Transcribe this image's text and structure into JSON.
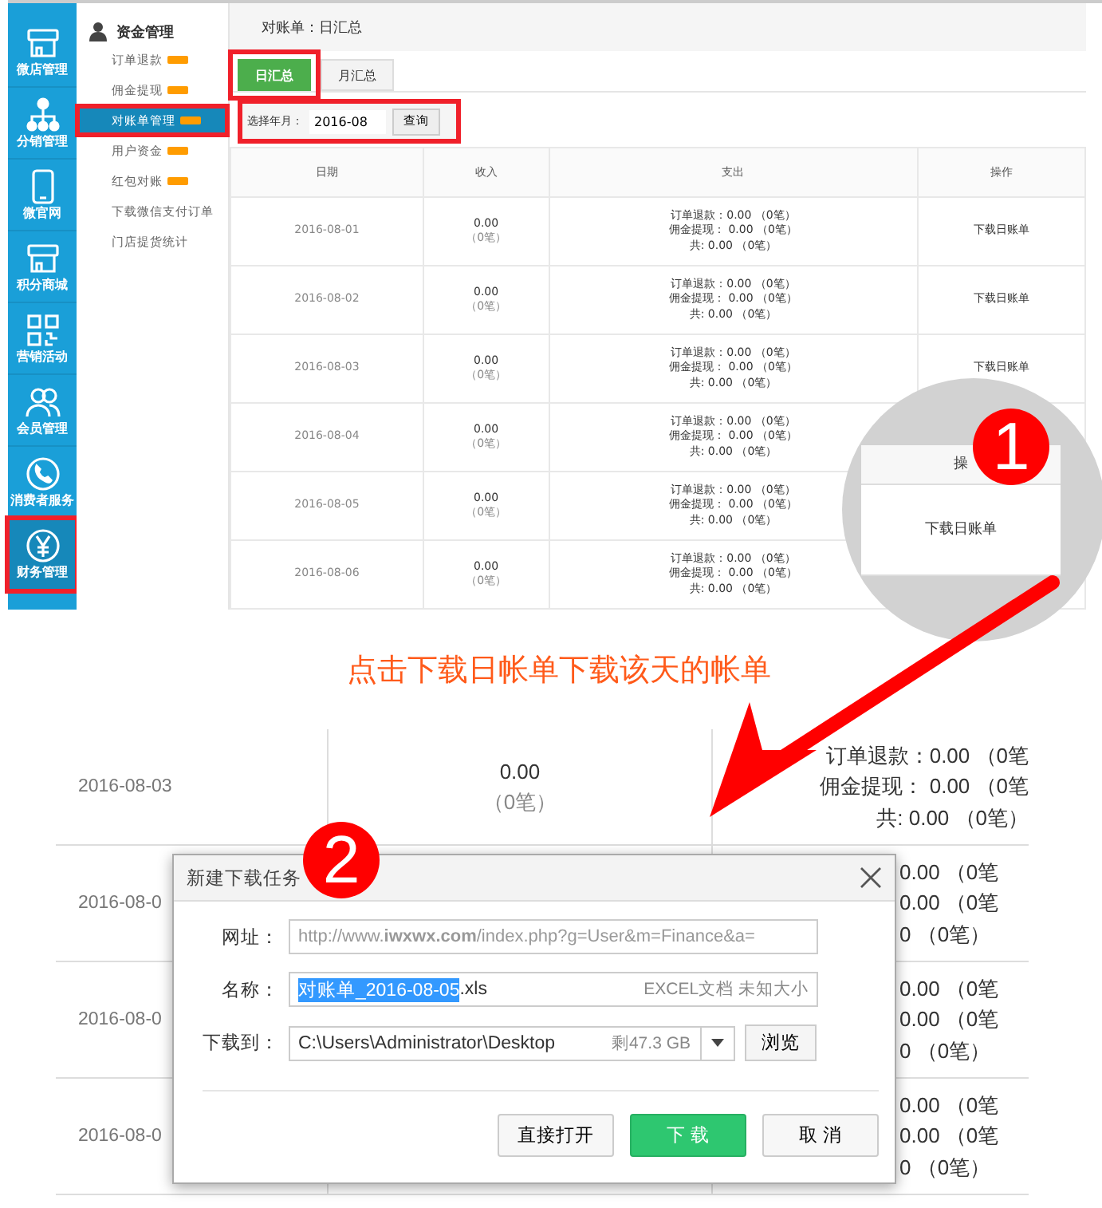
{
  "icon_sidebar": {
    "items": [
      {
        "label": "微店管理",
        "kind": "shop",
        "selected": false,
        "highlighted": false
      },
      {
        "label": "分销管理",
        "kind": "network",
        "selected": false,
        "highlighted": false
      },
      {
        "label": "微官网",
        "kind": "phone",
        "selected": false,
        "highlighted": false
      },
      {
        "label": "积分商城",
        "kind": "shop",
        "selected": false,
        "highlighted": false
      },
      {
        "label": "营销活动",
        "kind": "qr",
        "selected": false,
        "highlighted": false
      },
      {
        "label": "会员管理",
        "kind": "people",
        "selected": false,
        "highlighted": false
      },
      {
        "label": "消费者服务",
        "kind": "call",
        "selected": false,
        "highlighted": false
      },
      {
        "label": "财务管理",
        "kind": "yuan",
        "selected": true,
        "highlighted": true
      }
    ]
  },
  "submenu": {
    "title": "资金管理",
    "items": [
      {
        "label": "订单退款",
        "new": true,
        "selected": false,
        "highlighted": false
      },
      {
        "label": "佣金提现",
        "new": true,
        "selected": false,
        "highlighted": false
      },
      {
        "label": "对账单管理",
        "new": true,
        "selected": true,
        "highlighted": true
      },
      {
        "label": "用户资金",
        "new": true,
        "selected": false,
        "highlighted": false
      },
      {
        "label": "红包对账",
        "new": true,
        "selected": false,
        "highlighted": false
      },
      {
        "label": "下载微信支付订单",
        "new": false,
        "selected": false,
        "highlighted": false
      },
      {
        "label": "门店提货统计",
        "new": false,
        "selected": false,
        "highlighted": false
      }
    ]
  },
  "breadcrumb": "对账单：日汇总",
  "tabs": [
    {
      "label": "日汇总",
      "selected": true,
      "highlighted": true
    },
    {
      "label": "月汇总",
      "selected": false,
      "highlighted": false
    }
  ],
  "filter": {
    "label": "选择年月：",
    "value": "2016-08",
    "button": "查询",
    "highlighted": true
  },
  "table": {
    "columns": [
      "日期",
      "收入",
      "支出",
      "操作"
    ],
    "rows": [
      {
        "date": "2016-08-01",
        "income": "0.00",
        "income_count": "（0笔）",
        "expense_lines": [
          "订单退款：0.00 （0笔）",
          "佣金提现： 0.00 （0笔）",
          "共: 0.00 （0笔）"
        ],
        "action": "下载日账单"
      },
      {
        "date": "2016-08-02",
        "income": "0.00",
        "income_count": "（0笔）",
        "expense_lines": [
          "订单退款：0.00 （0笔）",
          "佣金提现： 0.00 （0笔）",
          "共: 0.00 （0笔）"
        ],
        "action": "下载日账单"
      },
      {
        "date": "2016-08-03",
        "income": "0.00",
        "income_count": "（0笔）",
        "expense_lines": [
          "订单退款：0.00 （0笔）",
          "佣金提现： 0.00 （0笔）",
          "共: 0.00 （0笔）"
        ],
        "action": "下载日账单"
      },
      {
        "date": "2016-08-04",
        "income": "0.00",
        "income_count": "（0笔）",
        "expense_lines": [
          "订单退款：0.00 （0笔）",
          "佣金提现： 0.00 （0笔）",
          "共: 0.00 （0笔）"
        ]
      },
      {
        "date": "2016-08-05",
        "income": "0.00",
        "income_count": "（0笔）",
        "expense_lines": [
          "订单退款：0.00 （0笔）",
          "佣金提现： 0.00 （0笔）",
          "共: 0.00 （0笔）"
        ]
      },
      {
        "date": "2016-08-06",
        "income": "0.00",
        "income_count": "（0笔）",
        "expense_lines": [
          "订单退款：0.00 （0笔）",
          "佣金提现： 0.00 （0笔）",
          "共: 0.00 （0笔）"
        ]
      }
    ]
  },
  "magnifier": {
    "header": "操",
    "action": "下载日账单",
    "step": "1"
  },
  "caption": "点击下载日帐单下载该天的帐单",
  "zoomed_table": {
    "rows": [
      {
        "kind": "full",
        "date": "2016-08-03",
        "income": "0.00",
        "income_count": "（0笔）",
        "expense_lines": [
          "订单退款：0.00 （0笔",
          "佣金提现： 0.00 （0笔",
          "共: 0.00 （0笔）"
        ]
      },
      {
        "kind": "covered",
        "date": "2016-08-0",
        "expense_lines": [
          "0.00 （0笔",
          "0.00 （0笔",
          "0 （0笔）"
        ]
      },
      {
        "kind": "covered",
        "date": "2016-08-0",
        "expense_lines": [
          "0.00 （0笔",
          "0.00 （0笔",
          "0 （0笔）"
        ]
      },
      {
        "kind": "covered",
        "date": "2016-08-0",
        "expense_lines": [
          "0.00 （0笔",
          "0.00 （0笔",
          "0 （0笔）"
        ]
      }
    ]
  },
  "dialog": {
    "title": "新建下载任务",
    "step": "2",
    "url": {
      "label": "网址：",
      "value": "http://www.**iwxwx.com**/index.php?g=User&m=Finance&a="
    },
    "name": {
      "label": "名称：",
      "selected_text": "对账单_2016-08-05",
      "rest_text": ".xls",
      "hint": "EXCEL文档 未知大小"
    },
    "path": {
      "label": "下载到：",
      "value": "C:\\Users\\Administrator\\Desktop",
      "free_space": "剩47.3 GB",
      "browse": "浏览"
    },
    "buttons": [
      {
        "label": "直接打开",
        "kind": "secondary"
      },
      {
        "label": "下 载",
        "kind": "primary"
      },
      {
        "label": "取 消",
        "kind": "secondary"
      }
    ]
  }
}
